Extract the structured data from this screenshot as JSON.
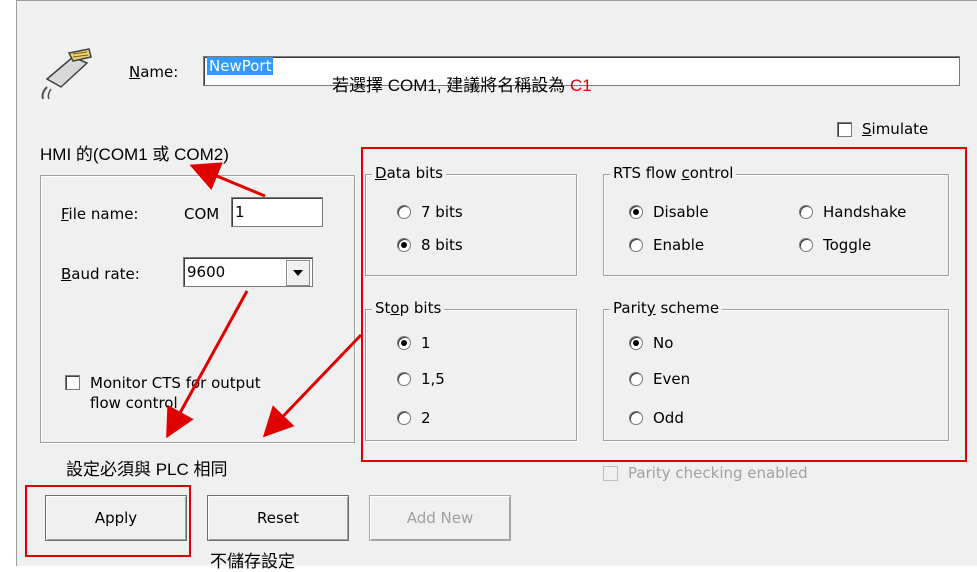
{
  "name_row": {
    "label": "Name:",
    "value": "NewPort"
  },
  "simulate": {
    "label": "Simulate",
    "checked": false
  },
  "file_name": {
    "label": "File name:",
    "prefix": "COM",
    "value": "1"
  },
  "baud_rate": {
    "label": "Baud rate:",
    "value": "9600"
  },
  "monitor_cts": {
    "line1": "Monitor CTS for output",
    "line2": "flow control",
    "checked": false
  },
  "data_bits": {
    "title": "Data bits",
    "options": [
      "7 bits",
      "8 bits"
    ],
    "selected": "8 bits"
  },
  "rts_flow": {
    "title": "RTS flow control",
    "options": [
      "Disable",
      "Handshake",
      "Enable",
      "Toggle"
    ],
    "selected": "Disable"
  },
  "stop_bits": {
    "title": "Stop bits",
    "options": [
      "1",
      "1,5",
      "2"
    ],
    "selected": "1"
  },
  "parity": {
    "title": "Parity scheme",
    "options": [
      "No",
      "Even",
      "Odd"
    ],
    "selected": "No"
  },
  "parity_checking": {
    "label": "Parity checking enabled",
    "enabled": false
  },
  "buttons": {
    "apply": "Apply",
    "reset": "Reset",
    "add_new": "Add New"
  },
  "annotations": {
    "name_hint_prefix": "若選擇 COM1, 建議將名稱設為 ",
    "name_hint_value": "C1",
    "hmi_port": "HMI 的(COM1 或 COM2)",
    "same_as_plc": "設定必須與 PLC 相同",
    "no_save": "不儲存設定"
  },
  "colors": {
    "annotation_red": "#e00000",
    "selection_blue": "#3399ff"
  }
}
